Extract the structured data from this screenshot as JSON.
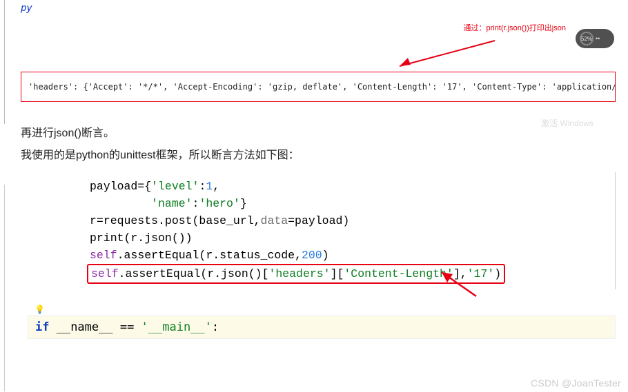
{
  "py_label": "py",
  "annotation": "通过：print(r.json())打印出json",
  "battery": {
    "percent": "52%"
  },
  "headers_line": "'headers': {'Accept': '*/*', 'Accept-Encoding': 'gzip, deflate', 'Content-Length': '17', 'Content-Type': 'application/x-",
  "watermark_windows": "激活 Windows",
  "text1": "再进行json()断言。",
  "text2": "我使用的是python的unittest框架，所以断言方法如下图：",
  "code": {
    "l1_pre": "payload={",
    "l1_k1": "'level'",
    "l1_sep": ":",
    "l1_v1": "1",
    "l1_comma": ",",
    "l2_sp": "         ",
    "l2_k2": "'name'",
    "l2_v2": "'hero'",
    "l2_close": "}",
    "l3_pre": "r=requests.post(base_url,",
    "l3_param": "data",
    "l3_rest": "=payload)",
    "l4": "print(r.json())",
    "l5_self": "self",
    "l5_mid": ".assertEqual(r.status_code,",
    "l5_num": "200",
    "l5_end": ")",
    "l6_self": "self",
    "l6_a": ".assertEqual(r.json()[",
    "l6_s1": "'headers'",
    "l6_b": "][",
    "l6_s2": "'Content-Length'",
    "l6_c": "],",
    "l6_s3": "'17'",
    "l6_d": ")"
  },
  "ifblock": {
    "if_kw": "if",
    "rest": " __name__ == ",
    "str": "'__main__'",
    "colon": ":"
  },
  "csdn": "CSDN @JoanTester"
}
